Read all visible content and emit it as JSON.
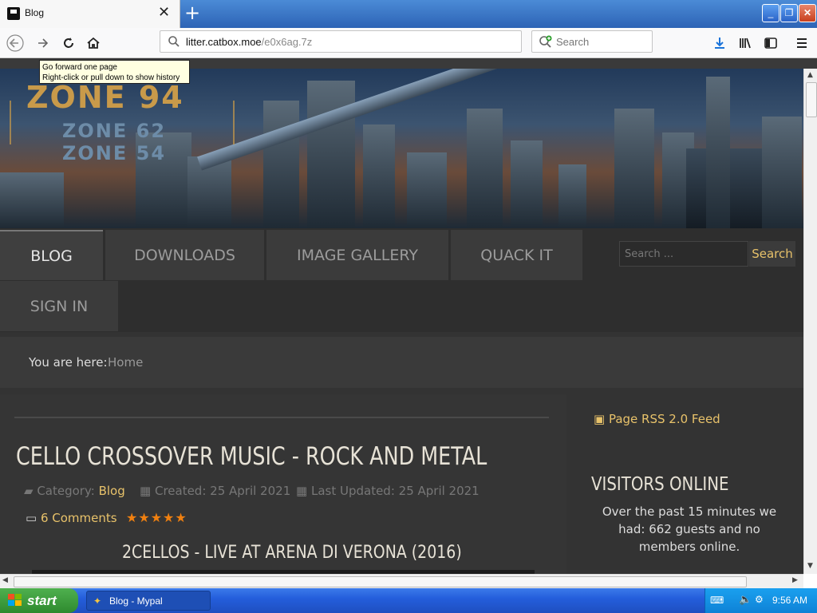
{
  "browser": {
    "tab_title": "Blog",
    "new_tab_label": "+",
    "url_host": "litter.catbox.moe",
    "url_path": "/e0x6ag.7z",
    "search_placeholder": "Search",
    "tooltip_line1": "Go forward one page",
    "tooltip_line2": "Right-click or pull down to show history"
  },
  "banner": {
    "logo_main": "ZONE 94",
    "logo_sub1": "ZONE 62",
    "logo_sub2": "ZONE 54"
  },
  "nav": {
    "items": [
      {
        "label": "BLOG",
        "active": true
      },
      {
        "label": "DOWNLOADS",
        "active": false
      },
      {
        "label": "IMAGE GALLERY",
        "active": false
      },
      {
        "label": "QUACK IT",
        "active": false
      },
      {
        "label": "SIGN IN",
        "active": false
      }
    ],
    "search_placeholder": "Search ...",
    "search_button": "Search"
  },
  "breadcrumb": {
    "label": "You are here:",
    "home": "Home"
  },
  "article": {
    "title": "CELLO CROSSOVER MUSIC - ROCK AND METAL",
    "category_label": "Category:",
    "category": "Blog",
    "created": "Created: 25 April 2021",
    "updated": "Last Updated: 25 April 2021",
    "comments": "6 Comments",
    "rating_stars": 5,
    "stars_text": "★★★★★",
    "subheading": "2CELLOS - LIVE AT ARENA DI VERONA (2016)"
  },
  "sidebar": {
    "rss_label": "Page RSS 2.0 Feed",
    "visitors_title": "VISITORS ONLINE",
    "visitors_text": "Over the past 15 minutes we had: 662 guests and no members online."
  },
  "taskbar": {
    "start_label": "start",
    "task_label": "Blog - Mypal",
    "clock": "9:56 AM"
  },
  "colors": {
    "accent": "#e8c26a",
    "star": "#f08010",
    "xp_blue": "#245edc"
  }
}
